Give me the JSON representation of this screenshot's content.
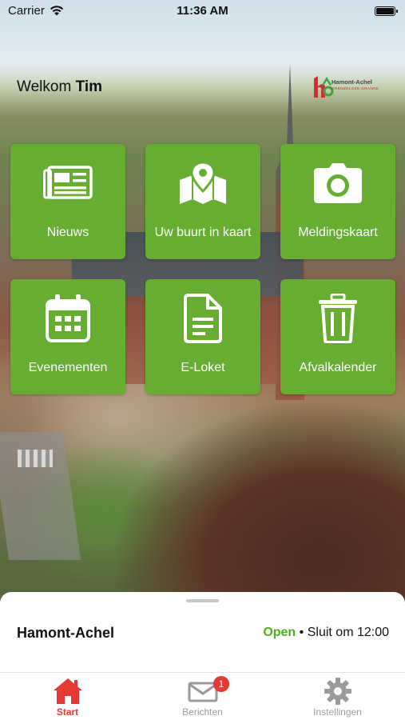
{
  "status_bar": {
    "carrier": "Carrier",
    "time": "11:36 AM"
  },
  "header": {
    "greeting": "Welkom",
    "user_name": "Tim",
    "logo": {
      "name": "Hamont-Achel",
      "tagline": "GRENZELOZE GRANNE"
    }
  },
  "tiles": [
    {
      "label": "Nieuws",
      "icon": "newspaper-icon"
    },
    {
      "label": "Uw buurt in kaart",
      "icon": "map-pin-icon"
    },
    {
      "label": "Meldingskaart",
      "icon": "camera-icon"
    },
    {
      "label": "Evenementen",
      "icon": "calendar-icon"
    },
    {
      "label": "E-Loket",
      "icon": "document-icon"
    },
    {
      "label": "Afvalkalender",
      "icon": "trash-icon"
    }
  ],
  "info_sheet": {
    "place": "Hamont-Achel",
    "status": "Open",
    "separator": "•",
    "closes": "Sluit om 12:00"
  },
  "tabbar": {
    "tabs": [
      {
        "label": "Start",
        "icon": "home-icon",
        "active": true
      },
      {
        "label": "Berichten",
        "icon": "mail-icon",
        "badge": "1"
      },
      {
        "label": "Instellingen",
        "icon": "gear-icon"
      }
    ]
  },
  "colors": {
    "tile_green": "#66ad31",
    "accent_red": "#e53935",
    "open_green": "#4caf1e"
  }
}
